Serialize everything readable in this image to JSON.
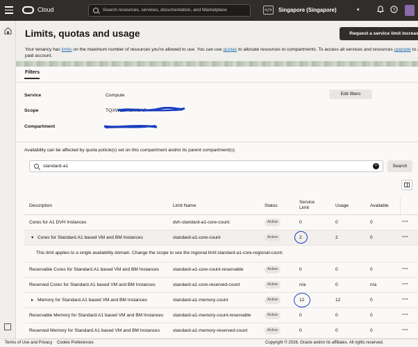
{
  "topbar": {
    "brand": "Cloud",
    "search_placeholder": "Search resources, services, documentation, and Marketplace",
    "code_icon_text": "</>",
    "region": "Singapore (Singapore)"
  },
  "header": {
    "title": "Limits, quotas and usage",
    "request_button": "Request a service limit increase",
    "intro_1": "Your tenancy has ",
    "intro_link_limits": "limits",
    "intro_2": " on the maximum number of resources you're allowed to use. You can use ",
    "intro_link_quotas": "quotas",
    "intro_3": " to allocate resources to compartments. To access all services and resources ",
    "intro_link_upgrade": "upgrade",
    "intro_4": " to a paid account."
  },
  "filters": {
    "tab": "Filters",
    "service_label": "Service",
    "service_value": "Compute",
    "scope_label": "Scope",
    "scope_value": "TQXW:AP-SINGAP",
    "compartment_label": "Compartment",
    "edit_button": "Edit filters"
  },
  "availability_note": "Availability can be affected by quota policie(s) set on this compartment and/or its parent compartment(s).",
  "search": {
    "value": "standard-a1",
    "clear_icon": "×",
    "button": "Search"
  },
  "table": {
    "headers": {
      "description": "Description",
      "limit_name": "Limit Name",
      "status": "Status",
      "service_limit_1": "Service",
      "service_limit_2": "Limit",
      "usage": "Usage",
      "available": "Available"
    },
    "rows": [
      {
        "expander": "",
        "description": "Cores for A1 DVH Instances",
        "limit_name": "dvh-standard-a1-core-count",
        "status": "Active",
        "service_limit": "0",
        "usage": "0",
        "available": "0"
      },
      {
        "expander": "▾",
        "description": "Cores for Standard.A1 based VM and BM Instances",
        "limit_name": "standard-a1-core-count",
        "status": "Active",
        "service_limit": "2",
        "usage": "2",
        "available": "0"
      },
      {
        "expander": "",
        "description": "Reservable Cores for Standard.A1 based VM and BM Instances",
        "limit_name": "standard-a1-core-count-reservable",
        "status": "Active",
        "service_limit": "0",
        "usage": "0",
        "available": "0"
      },
      {
        "expander": "",
        "description": "Reserved Cores for Standard.A1 based VM and BM Instances",
        "limit_name": "standard-a1-core-reserved-count",
        "status": "Active",
        "service_limit": "n/a",
        "usage": "0",
        "available": "n/a"
      },
      {
        "expander": "▸",
        "description": "Memory for Standard.A1 based VM and BM Instances",
        "limit_name": "standard-a1-memory-count",
        "status": "Active",
        "service_limit": "12",
        "usage": "12",
        "available": "0"
      },
      {
        "expander": "",
        "description": "Reservable Memory for Standard.A1 based VM and BM Instances",
        "limit_name": "standard-a1-memory-count-reservable",
        "status": "Active",
        "service_limit": "0",
        "usage": "0",
        "available": "0"
      },
      {
        "expander": "",
        "description": "Reserved Memory for Standard.A1 based VM and BM Instances",
        "limit_name": "standard-a1-memory-reserved-count",
        "status": "Active",
        "service_limit": "0",
        "usage": "0",
        "available": "0"
      }
    ],
    "expanded_note": "This limit applies to a single availability domain. Change the scope to see the regional limit:standard-a1-core-regional-count.",
    "actions_icon": "···"
  },
  "footer": {
    "terms": "Terms of Use and Privacy",
    "cookies": "Cookie Preferences",
    "copyright": "Copyright © 2026, Oracle and/or its affiliates. All rights reserved."
  },
  "colors": {
    "topbar_bg": "#312d2a",
    "link": "#1f6fb0",
    "annotation_ink": "#1a3fbf",
    "avatar": "#8b6aa9"
  },
  "icons": [
    "hamburger-menu-icon",
    "oracle-logo-icon",
    "search-icon",
    "code-editor-icon",
    "chevron-down-icon",
    "bell-icon",
    "help-icon",
    "globe-icon",
    "home-icon",
    "columns-icon",
    "clear-icon",
    "more-actions-icon"
  ]
}
